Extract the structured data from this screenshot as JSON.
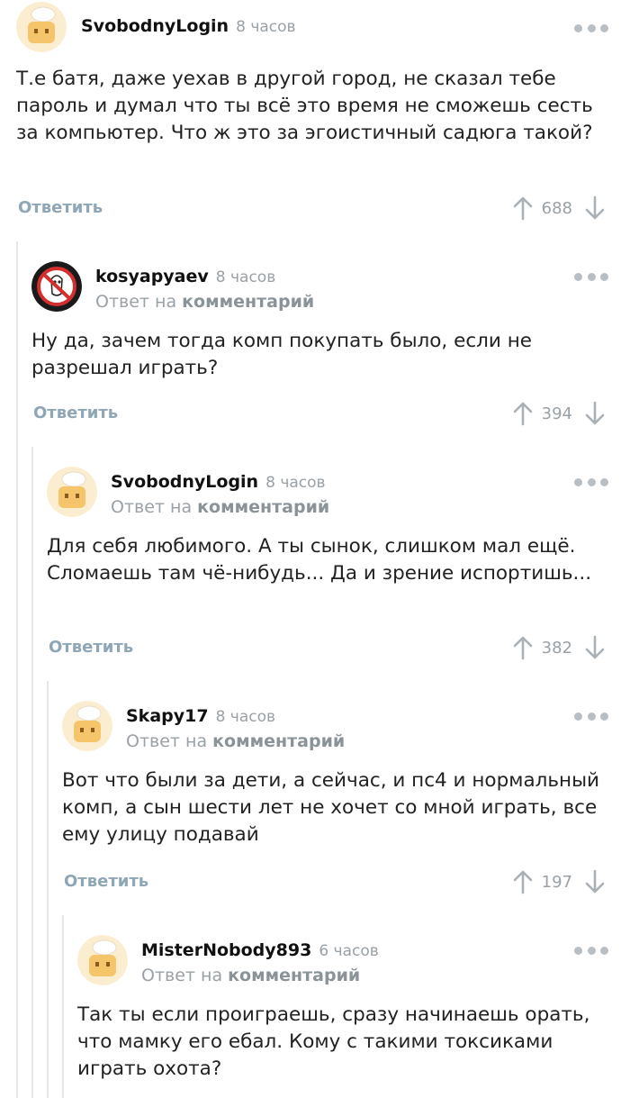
{
  "common": {
    "reply_to_prefix": "Ответ на",
    "reply_to_link": "комментарий",
    "reply_label": "Ответить"
  },
  "comments": [
    {
      "author": "SvobodnyLogin",
      "time": "8 часов",
      "text": "Т.е батя, даже уехав в другой город, не сказал тебе пароль и думал что ты всё это время не сможешь сесть за компьютер. Что ж это за эгоистичный садюга такой?",
      "rating": "688",
      "avatar": "chef-toast-avatar"
    },
    {
      "author": "kosyapyaev",
      "time": "8 часов",
      "text": "Ну да, зачем тогда комп покупать было, если не разрешал играть?",
      "rating": "394",
      "avatar": "ghostbusters-avatar"
    },
    {
      "author": "SvobodnyLogin",
      "time": "8 часов",
      "text": "Для себя любимого. А ты сынок, слишком мал ещё. Сломаешь там чё-нибудь... Да и зрение испортишь...",
      "rating": "382",
      "avatar": "chef-toast-avatar"
    },
    {
      "author": "Skapy17",
      "time": "8 часов",
      "text": "Вот что были за дети, а сейчас, и пс4 и нормальный комп, а сын шести лет не хочет со мной играть, все ему улицу подавай",
      "rating": "197",
      "avatar": "chef-toast-avatar"
    },
    {
      "author": "MisterNobody893",
      "time": "6 часов",
      "text": "Так ты если проиграешь, сразу начинаешь орать, что мамку его ебал. Кому с такими токсиками играть охота?",
      "avatar": "chef-toast-avatar"
    }
  ],
  "colors": {
    "link": "#8ea6b5",
    "muted": "#9aa1a6",
    "rail": "#e4e8eb",
    "avatar_bg": "#fbeed0",
    "toast": "#f5c56b"
  }
}
